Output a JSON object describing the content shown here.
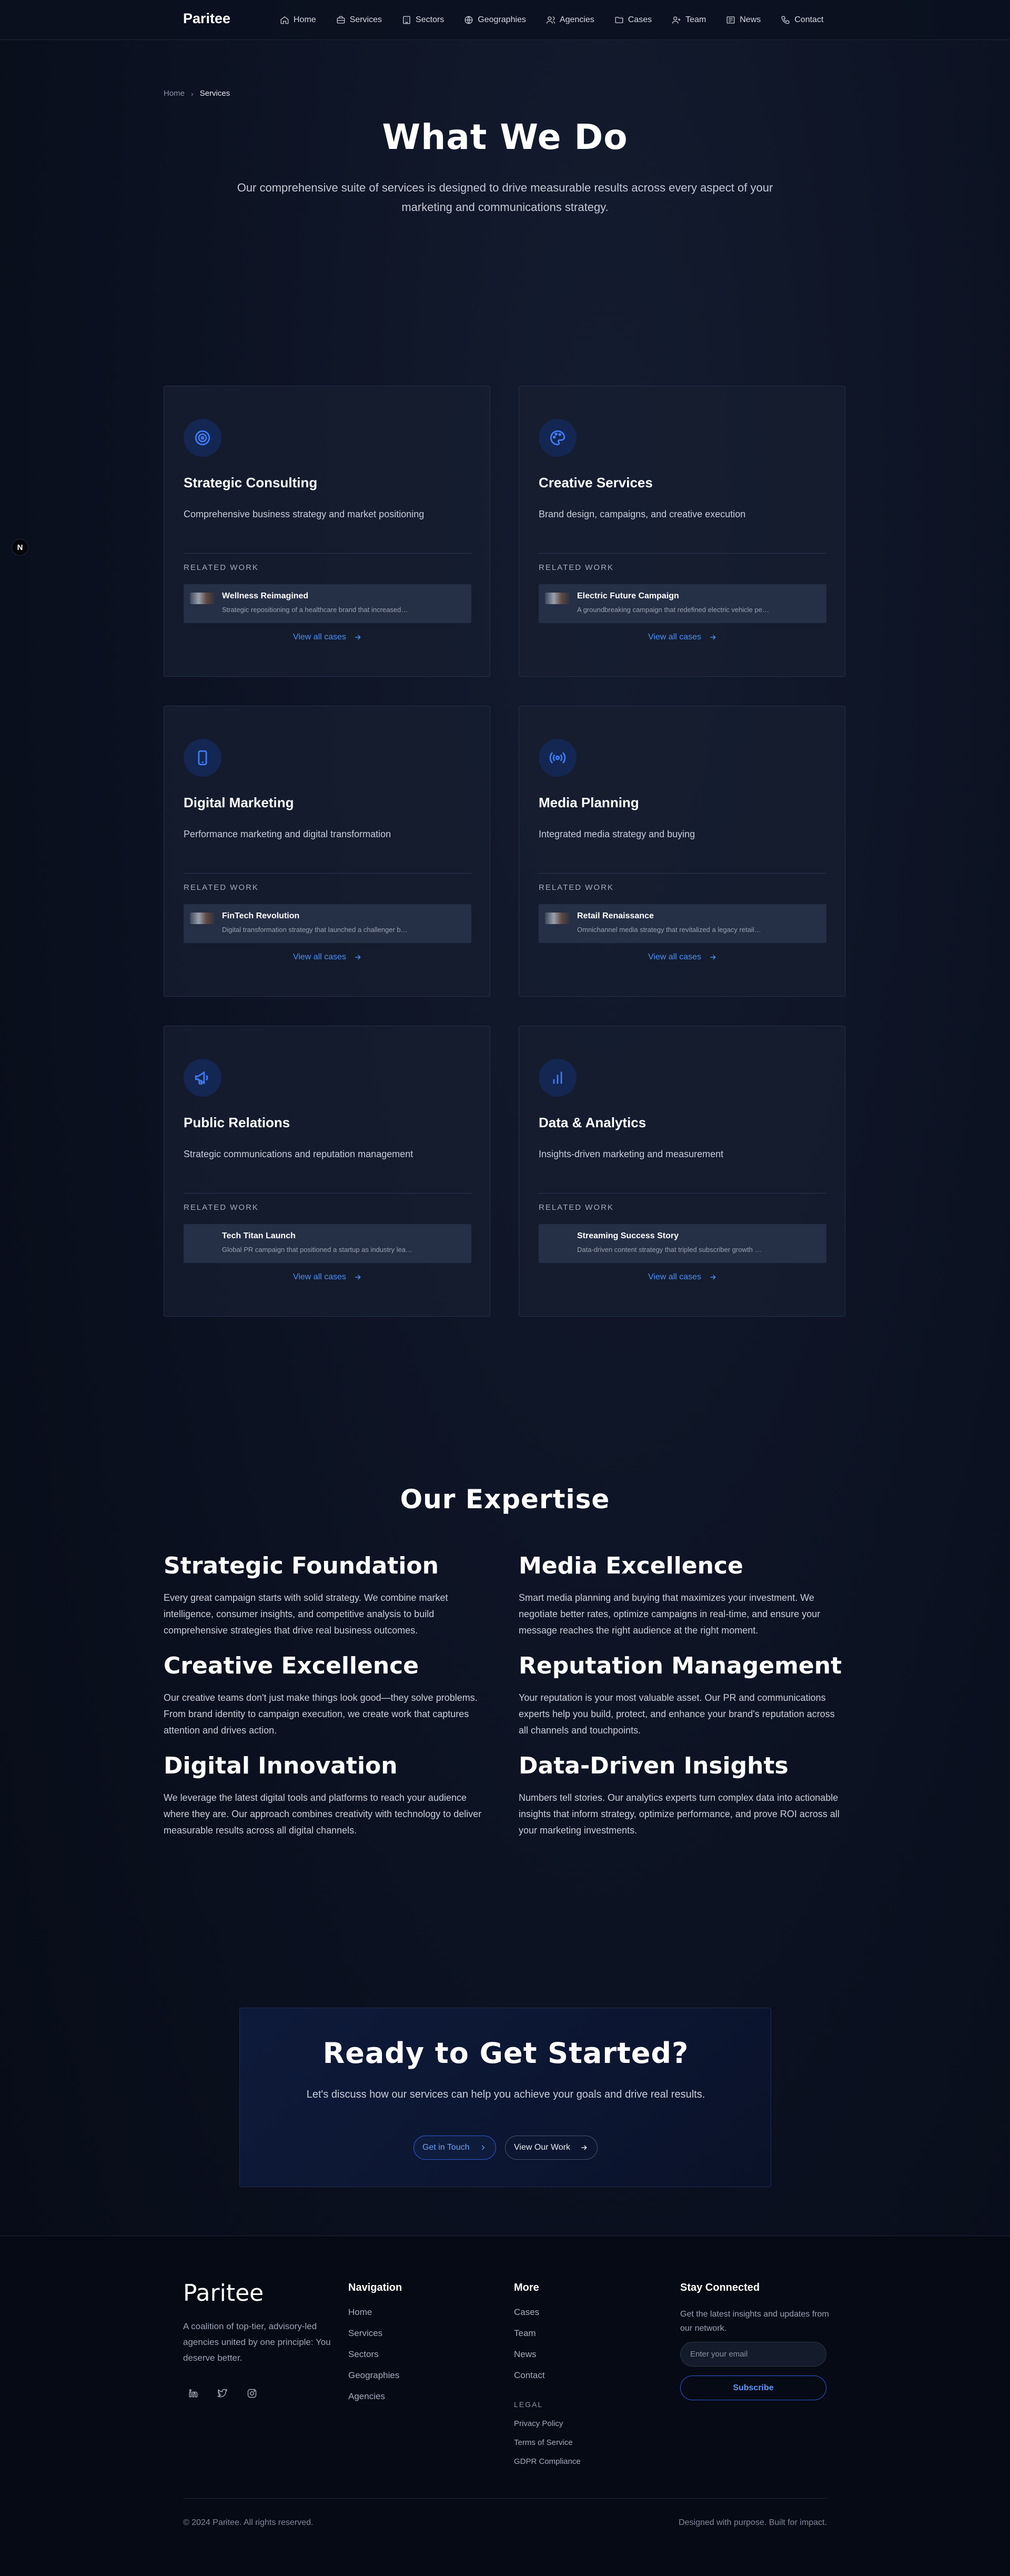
{
  "nav": {
    "brand": "Paritee",
    "items": [
      {
        "label": "Home",
        "icon": "home-icon"
      },
      {
        "label": "Services",
        "icon": "briefcase-icon"
      },
      {
        "label": "Sectors",
        "icon": "building-icon"
      },
      {
        "label": "Geographies",
        "icon": "globe-icon"
      },
      {
        "label": "Agencies",
        "icon": "users-icon"
      },
      {
        "label": "Cases",
        "icon": "folder-icon"
      },
      {
        "label": "Team",
        "icon": "user-plus-icon"
      },
      {
        "label": "News",
        "icon": "newspaper-icon"
      },
      {
        "label": "Contact",
        "icon": "phone-icon"
      }
    ]
  },
  "floating_badge": "N",
  "breadcrumb": {
    "home": "Home",
    "separator": "›",
    "current": "Services"
  },
  "hero": {
    "title": "What We Do",
    "subtitle": "Our comprehensive suite of services is designed to drive measurable results across every aspect of your marketing and communications strategy."
  },
  "services": [
    {
      "title": "Strategic Consulting",
      "desc": "Comprehensive business strategy and market positioning",
      "icon": "target-icon",
      "related_label": "RELATED WORK",
      "case_title": "Wellness Reimagined",
      "case_desc": "Strategic repositioning of a healthcare brand that increased…",
      "view_all": "View all cases"
    },
    {
      "title": "Creative Services",
      "desc": "Brand design, campaigns, and creative execution",
      "icon": "palette-icon",
      "related_label": "RELATED WORK",
      "case_title": "Electric Future Campaign",
      "case_desc": "A groundbreaking campaign that redefined electric vehicle pe…",
      "view_all": "View all cases"
    },
    {
      "title": "Digital Marketing",
      "desc": "Performance marketing and digital transformation",
      "icon": "smartphone-icon",
      "related_label": "RELATED WORK",
      "case_title": "FinTech Revolution",
      "case_desc": "Digital transformation strategy that launched a challenger b…",
      "view_all": "View all cases"
    },
    {
      "title": "Media Planning",
      "desc": "Integrated media strategy and buying",
      "icon": "broadcast-icon",
      "related_label": "RELATED WORK",
      "case_title": "Retail Renaissance",
      "case_desc": "Omnichannel media strategy that revitalized a legacy retail…",
      "view_all": "View all cases"
    },
    {
      "title": "Public Relations",
      "desc": "Strategic communications and reputation management",
      "icon": "megaphone-icon",
      "related_label": "RELATED WORK",
      "case_title": "Tech Titan Launch",
      "case_desc": "Global PR campaign that positioned a startup as industry lea…",
      "view_all": "View all cases"
    },
    {
      "title": "Data & Analytics",
      "desc": "Insights-driven marketing and measurement",
      "icon": "bar-chart-icon",
      "related_label": "RELATED WORK",
      "case_title": "Streaming Success Story",
      "case_desc": "Data-driven content strategy that tripled subscriber growth …",
      "view_all": "View all cases"
    }
  ],
  "expertise": {
    "heading": "Our Expertise",
    "items": [
      {
        "title": "Strategic Foundation",
        "text": "Every great campaign starts with solid strategy. We combine market intelligence, consumer insights, and competitive analysis to build comprehensive strategies that drive real business outcomes."
      },
      {
        "title": "Media Excellence",
        "text": "Smart media planning and buying that maximizes your investment. We negotiate better rates, optimize campaigns in real-time, and ensure your message reaches the right audience at the right moment."
      },
      {
        "title": "Creative Excellence",
        "text": "Our creative teams don't just make things look good—they solve problems. From brand identity to campaign execution, we create work that captures attention and drives action."
      },
      {
        "title": "Reputation Management",
        "text": "Your reputation is your most valuable asset. Our PR and communications experts help you build, protect, and enhance your brand's reputation across all channels and touchpoints."
      },
      {
        "title": "Digital Innovation",
        "text": "We leverage the latest digital tools and platforms to reach your audience where they are. Our approach combines creativity with technology to deliver measurable results across all digital channels."
      },
      {
        "title": "Data-Driven Insights",
        "text": "Numbers tell stories. Our analytics experts turn complex data into actionable insights that inform strategy, optimize performance, and prove ROI across all your marketing investments."
      }
    ]
  },
  "cta": {
    "title": "Ready to Get Started?",
    "subtitle": "Let's discuss how our services can help you achieve your goals and drive real results.",
    "primary": "Get in Touch",
    "secondary": "View Our Work"
  },
  "footer": {
    "brand": "Paritee",
    "tagline": "A coalition of top-tier, advisory-led agencies united by one principle: You deserve better.",
    "social": [
      "linkedin-icon",
      "twitter-icon",
      "instagram-icon"
    ],
    "navigation": {
      "title": "Navigation",
      "links": [
        "Home",
        "Services",
        "Sectors",
        "Geographies",
        "Agencies"
      ]
    },
    "more": {
      "title": "More",
      "links": [
        "Cases",
        "Team",
        "News",
        "Contact"
      ]
    },
    "legal": {
      "title": "LEGAL",
      "links": [
        "Privacy Policy",
        "Terms of Service",
        "GDPR Compliance"
      ]
    },
    "newsletter": {
      "title": "Stay Connected",
      "text": "Get the latest insights and updates from our network.",
      "placeholder": "Enter your email",
      "button": "Subscribe"
    },
    "copyright": "© 2024 Paritee. All rights reserved.",
    "motto": "Designed with purpose. Built for impact."
  },
  "colors": {
    "accent": "#3f7cf5",
    "background": "#0b1120",
    "card": "#161e30"
  }
}
